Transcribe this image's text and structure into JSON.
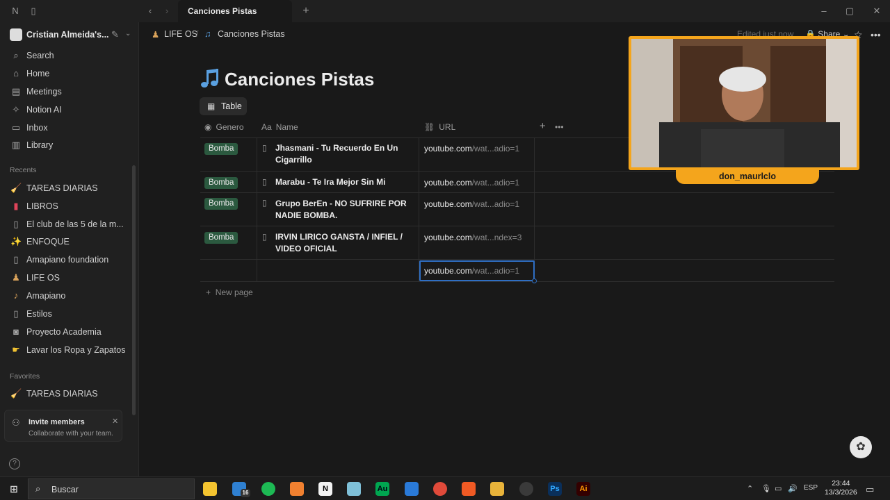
{
  "tab": {
    "title": "Canciones Pistas"
  },
  "workspace": {
    "name": "Cristian Almeida's..."
  },
  "nav": [
    {
      "label": "Search",
      "icon": "search-icon"
    },
    {
      "label": "Home",
      "icon": "home-icon"
    },
    {
      "label": "Meetings",
      "icon": "meetings-icon"
    },
    {
      "label": "Notion AI",
      "icon": "ai-icon"
    },
    {
      "label": "Inbox",
      "icon": "inbox-icon"
    },
    {
      "label": "Library",
      "icon": "library-icon"
    }
  ],
  "recents": {
    "heading": "Recents",
    "items": [
      {
        "label": "TAREAS DIARIAS",
        "icon": "broom-icon"
      },
      {
        "label": "LIBROS",
        "icon": "book-icon"
      },
      {
        "label": "El club de las 5 de la m...",
        "icon": "page-icon"
      },
      {
        "label": "ENFOQUE",
        "icon": "sparkle-icon"
      },
      {
        "label": "Amapiano foundation",
        "icon": "page-icon"
      },
      {
        "label": "LIFE OS",
        "icon": "person-icon"
      },
      {
        "label": "Amapiano",
        "icon": "music-icon"
      },
      {
        "label": "Estilos",
        "icon": "page-icon"
      },
      {
        "label": "Proyecto Academia",
        "icon": "chat-icon"
      },
      {
        "label": "Lavar los Ropa y Zapatos",
        "icon": "hand-icon"
      }
    ]
  },
  "favorites": {
    "heading": "Favorites",
    "items": [
      {
        "label": "TAREAS DIARIAS",
        "icon": "broom-icon"
      }
    ]
  },
  "invite": {
    "title": "Invite members",
    "subtitle": "Collaborate with your team."
  },
  "breadcrumb": {
    "parent": "LIFE OS",
    "current": "Canciones Pistas"
  },
  "topbar": {
    "edited": "Edited just now",
    "share": "Share"
  },
  "page": {
    "title": "Canciones Pistas",
    "view": "Table",
    "columns": {
      "genre": "Genero",
      "name": "Name",
      "url": "URL"
    },
    "rows": [
      {
        "genre": "Bomba",
        "name": "Jhasmani - Tu Recuerdo En Un Cigarrillo",
        "url_main": "youtube.com",
        "url_rest": "/wat...adio=1"
      },
      {
        "genre": "Bomba",
        "name": "Marabu - Te Ira Mejor Sin Mi",
        "url_main": "youtube.com",
        "url_rest": "/wat...adio=1"
      },
      {
        "genre": "Bomba",
        "name": "Grupo BerEn - NO SUFRIRE POR NADIE BOMBA.",
        "url_main": "youtube.com",
        "url_rest": "/wat...adio=1"
      },
      {
        "genre": "Bomba",
        "name": "IRVIN LIRICO GANSTA / INFIEL / VIDEO OFICIAL",
        "url_main": "youtube.com",
        "url_rest": "/wat...ndex=3"
      },
      {
        "genre": "",
        "name": "",
        "url_main": "youtube.com",
        "url_rest": "/wat...adio=1"
      }
    ],
    "new_page": "New page"
  },
  "webcam": {
    "username": "don_maurlclo"
  },
  "taskbar": {
    "search_placeholder": "Buscar",
    "badge_count": "16",
    "lang": "ESP",
    "time": "23:44",
    "date": "13/3/2026"
  },
  "colors": {
    "accent": "#2f6fc4",
    "badge": "#2b593f",
    "cam_border": "#f4a51c"
  }
}
